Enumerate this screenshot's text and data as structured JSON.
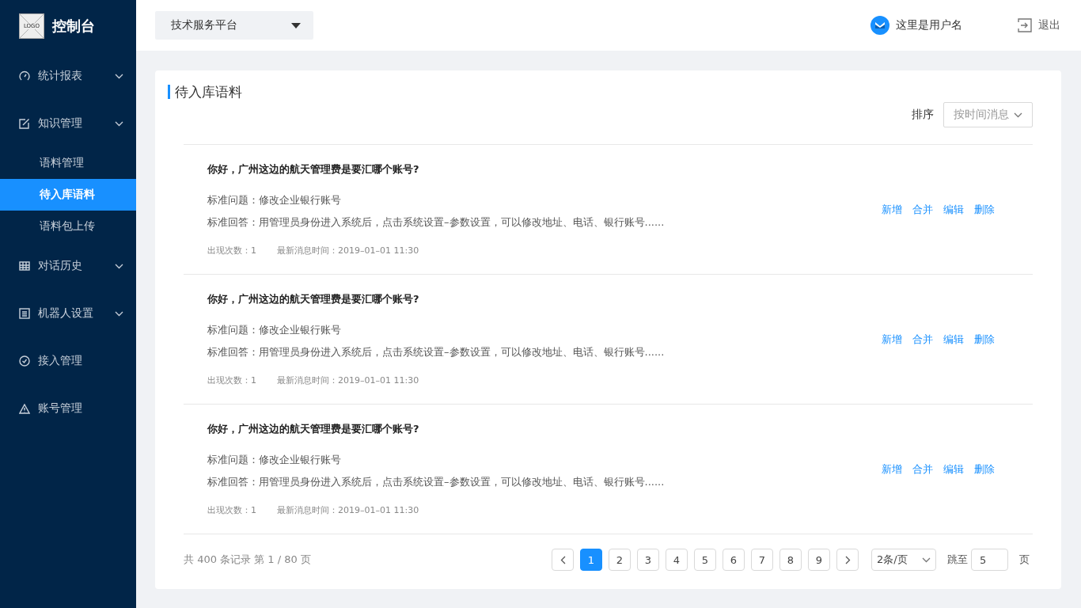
{
  "sidebar": {
    "logo_text": "LOGO",
    "title": "控制台",
    "items": [
      {
        "label": "统计报表",
        "has_submenu": true
      },
      {
        "label": "知识管理",
        "has_submenu": true,
        "children": [
          {
            "label": "语料管理",
            "selected": false
          },
          {
            "label": "待入库语料",
            "selected": true
          },
          {
            "label": "语料包上传",
            "selected": false
          }
        ]
      },
      {
        "label": "对话历史",
        "has_submenu": true
      },
      {
        "label": "机器人设置",
        "has_submenu": true
      },
      {
        "label": "接入管理",
        "has_submenu": false
      },
      {
        "label": "账号管理",
        "has_submenu": false
      }
    ]
  },
  "header": {
    "platform_select": "技术服务平台",
    "username": "这里是用户名",
    "logout": "退出"
  },
  "panel": {
    "title": "待入库语料",
    "sort_label": "排序",
    "sort_select": "按时间消息",
    "entries": [
      {
        "question": "你好，广州这边的航天管理费是要汇哪个账号?",
        "standard_question": "标准问题：修改企业银行账号",
        "standard_answer": "标准回答：用管理员身份进入系统后，点击系统设置–参数设置，可以修改地址、电话、银行账号......",
        "count": "出现次数：1",
        "time": "最新消息时间：2019–01–01 11:30",
        "actions": [
          "新增",
          "合并",
          "编辑",
          "删除"
        ]
      },
      {
        "question": "你好，广州这边的航天管理费是要汇哪个账号?",
        "standard_question": "标准问题：修改企业银行账号",
        "standard_answer": "标准回答：用管理员身份进入系统后，点击系统设置–参数设置，可以修改地址、电话、银行账号......",
        "count": "出现次数：1",
        "time": "最新消息时间：2019–01–01 11:30",
        "actions": [
          "新增",
          "合并",
          "编辑",
          "删除"
        ]
      },
      {
        "question": "你好，广州这边的航天管理费是要汇哪个账号?",
        "standard_question": "标准问题：修改企业银行账号",
        "standard_answer": "标准回答：用管理员身份进入系统后，点击系统设置–参数设置，可以修改地址、电话、银行账号......",
        "count": "出现次数：1",
        "time": "最新消息时间：2019–01–01 11:30",
        "actions": [
          "新增",
          "合并",
          "编辑",
          "删除"
        ]
      }
    ],
    "pagination": {
      "summary": "共 400 条记录 第 1 / 80 页",
      "pages": [
        {
          "label": "1",
          "selected": true
        },
        {
          "label": "2",
          "selected": false
        },
        {
          "label": "3",
          "selected": false
        },
        {
          "label": "4",
          "selected": false
        },
        {
          "label": "5",
          "selected": false
        },
        {
          "label": "6",
          "selected": false
        },
        {
          "label": "7",
          "selected": false
        },
        {
          "label": "8",
          "selected": false
        },
        {
          "label": "9",
          "selected": false
        }
      ],
      "page_size": "2条/页",
      "jump_label": "跳至",
      "jump_value": "5",
      "page_unit": "页"
    }
  }
}
